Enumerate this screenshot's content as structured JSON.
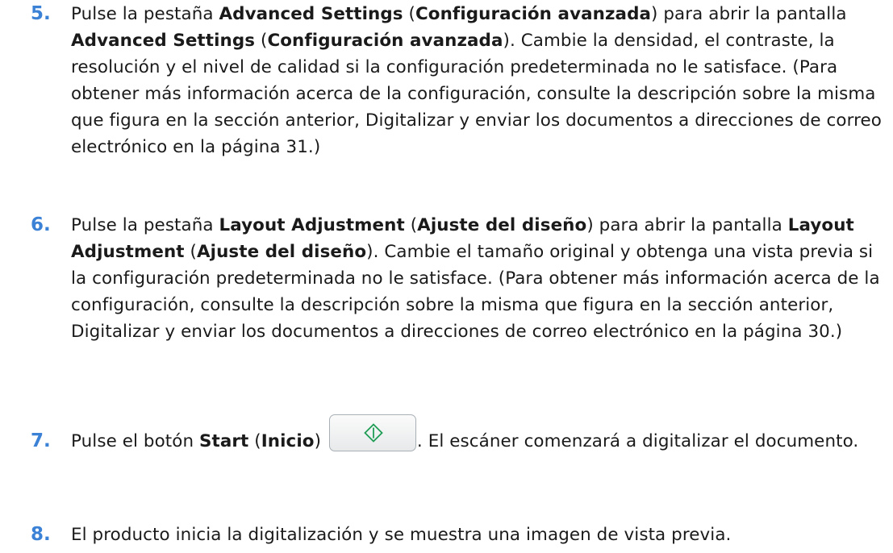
{
  "steps": [
    {
      "number": "5.",
      "parts": [
        {
          "t": "Pulse la pestaña "
        },
        {
          "t": "Advanced Settings",
          "b": true
        },
        {
          "t": " ("
        },
        {
          "t": "Configuración avanzada",
          "b": true
        },
        {
          "t": ") para abrir la pantalla "
        },
        {
          "t": "Advanced Settings",
          "b": true
        },
        {
          "t": " ("
        },
        {
          "t": "Configuración avanzada",
          "b": true
        },
        {
          "t": "). Cambie la densidad, el contraste, la resolución y el nivel de calidad si la configuración predeterminada no le satisface. (Para obtener más información acerca de la configuración, consulte la descripción sobre la misma que figura en la sección anterior, Digitalizar y enviar los documentos a direcciones de correo electrónico en la página 31.)"
        }
      ]
    },
    {
      "number": "6.",
      "parts": [
        {
          "t": "Pulse la pestaña "
        },
        {
          "t": "Layout Adjustment",
          "b": true
        },
        {
          "t": " ("
        },
        {
          "t": "Ajuste del diseño",
          "b": true
        },
        {
          "t": ") para abrir la pantalla "
        },
        {
          "t": "Layout Adjustment",
          "b": true
        },
        {
          "t": " ("
        },
        {
          "t": "Ajuste del diseño",
          "b": true
        },
        {
          "t": "). Cambie el tamaño original y obtenga una vista previa si la configuración predeterminada no le satisface. (Para obtener más información acerca de la configuración, consulte la descripción sobre la misma que figura en la sección anterior, Digitalizar y enviar los documentos a direcciones de correo electrónico en la página 30.)"
        }
      ]
    },
    {
      "number": "7.",
      "parts": [
        {
          "t": "Pulse el botón "
        },
        {
          "t": "Start",
          "b": true
        },
        {
          "t": " ("
        },
        {
          "t": "Inicio",
          "b": true
        },
        {
          "t": ") "
        },
        {
          "icon": "start-button"
        },
        {
          "t": ". El escáner comenzará a digitalizar el documento."
        }
      ]
    },
    {
      "number": "8.",
      "parts": [
        {
          "t": "El producto inicia la digitalización y se muestra una imagen de vista previa."
        }
      ]
    }
  ],
  "colors": {
    "step_number": "#3b82d6",
    "start_icon": "#1f9d55"
  }
}
